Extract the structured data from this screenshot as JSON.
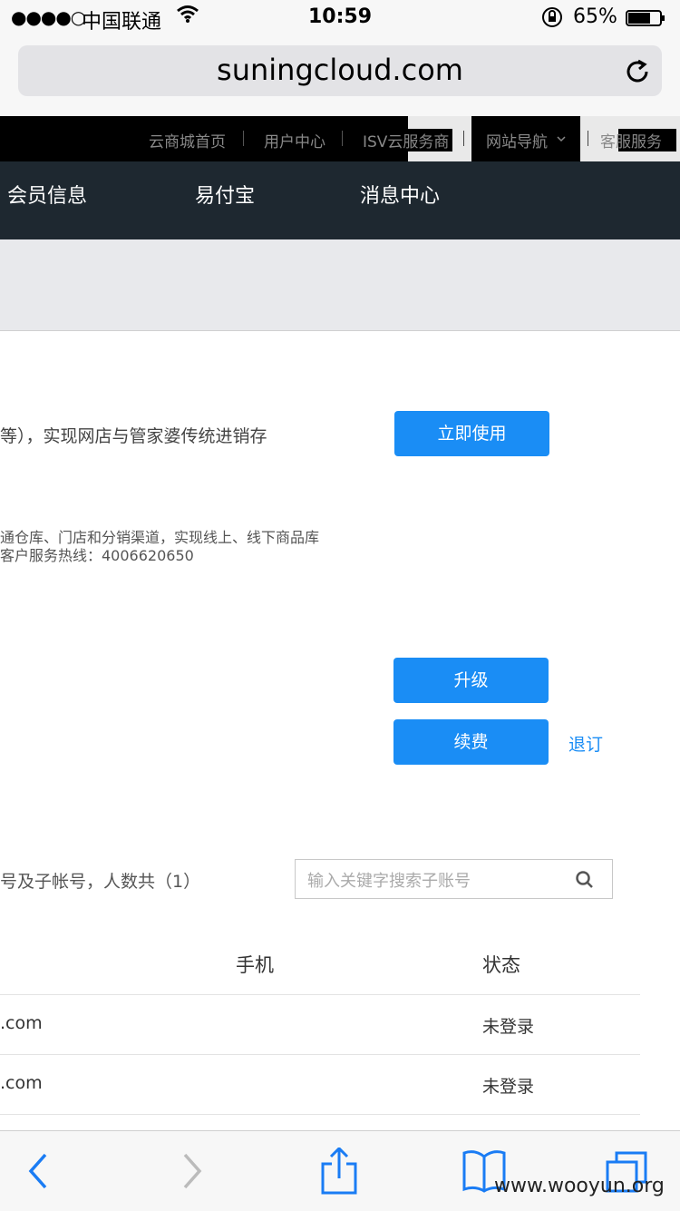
{
  "status_bar": {
    "signal": "●●●●○",
    "carrier": "中国联通",
    "time": "10:59",
    "battery": "65%",
    "icons": [
      "signal-dots",
      "wifi-icon",
      "rotation-lock-icon",
      "battery-icon"
    ]
  },
  "browser": {
    "url": "suningcloud.com",
    "reload_icon": "reload-icon"
  },
  "top_nav": {
    "items": [
      "云商城首页",
      "用户中心",
      "ISV云服务商",
      "网站导航",
      "客服服务"
    ],
    "dropdown_icon": "chevron-down-icon"
  },
  "main_nav": {
    "items": [
      "会员信息",
      "易付宝",
      "消息中心"
    ]
  },
  "content": {
    "desc1": "等），实现网店与管家婆传统进销存",
    "use_now": "立即使用",
    "desc2_line1": "通仓库、门店和分销渠道，实现线上、线下商品库",
    "desc2_line2": "客户服务热线：4006620650",
    "upgrade": "升级",
    "renew": "续费",
    "unsubscribe": "退订",
    "sub_account_summary": "号及子帐号，人数共（1）",
    "search_placeholder": "输入关键字搜索子账号"
  },
  "table": {
    "headers": [
      "手机",
      "状态"
    ],
    "rows": [
      {
        "account": ".com",
        "phone": "",
        "status": "未登录"
      },
      {
        "account": ".com",
        "phone": "",
        "status": "未登录"
      }
    ]
  },
  "toolbar": {
    "icons": [
      "back-icon",
      "forward-icon",
      "share-icon",
      "bookmarks-icon",
      "tabs-icon"
    ],
    "watermark": "www.wooyun.org"
  },
  "colors": {
    "accent": "#1a8df5",
    "main_nav_bg": "#1e2830",
    "top_nav_bg": "#000000"
  }
}
